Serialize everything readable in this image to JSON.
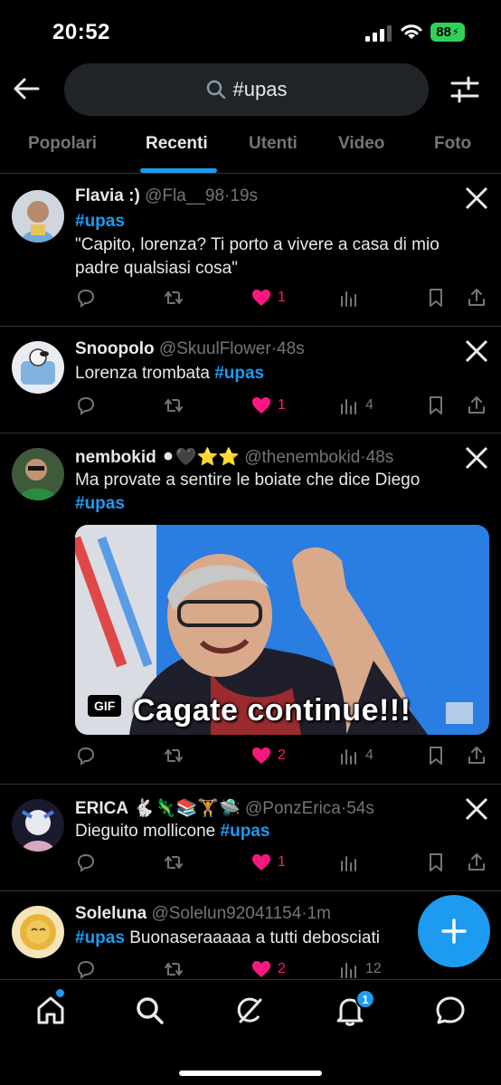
{
  "status_bar": {
    "time": "20:52",
    "battery": "88"
  },
  "search": {
    "query": "#upas"
  },
  "tabs": [
    {
      "label": "Popolari"
    },
    {
      "label": "Recenti"
    },
    {
      "label": "Utenti"
    },
    {
      "label": "Video"
    },
    {
      "label": "Foto"
    }
  ],
  "active_tab": "Recenti",
  "colors": {
    "accent": "#1d9bf0",
    "like": "#f91880",
    "muted": "#71767b",
    "background": "#000000"
  },
  "tweets": [
    {
      "name": "Flavia :)",
      "handle": "@Fla__98",
      "time": "19s",
      "hashtag": "#upas",
      "text": "\"Capito, lorenza? Ti porto a vivere a casa di mio padre qualsiasi cosa\"",
      "likes": "1",
      "views": ""
    },
    {
      "name": "Snoopolo",
      "handle": "@SkuulFlower",
      "time": "48s",
      "text": "Lorenza trombata ",
      "hashtag": "#upas",
      "likes": "1",
      "views": "4"
    },
    {
      "name": "nembokid",
      "name_emoji": "⚫🖤⭐⭐",
      "handle": "@thenembokid",
      "time": "48s",
      "text": "Ma provate a sentire le boiate che dice Diego",
      "hashtag": "#upas",
      "media": {
        "badge": "GIF",
        "caption": "Cagate continue!!!"
      },
      "likes": "2",
      "views": "4"
    },
    {
      "name": "ERICA",
      "name_emoji": "🐇🦎📚🏋🛸",
      "handle": "@PonzErica",
      "time": "54s",
      "text": "Dieguito mollicone ",
      "hashtag": "#upas",
      "likes": "1",
      "views": ""
    },
    {
      "name": "Soleluna",
      "handle": "@Solelun92041154",
      "time": "1m",
      "hashtag": "#upas",
      "text": " Buonaseraaaaa a tutti debosciati",
      "likes": "2",
      "views": "12"
    }
  ],
  "bottom_nav": {
    "notifications_badge": "1"
  },
  "icons": [
    "back-icon",
    "search-icon",
    "filter-icon",
    "x-logo-icon",
    "reply-icon",
    "retweet-icon",
    "heart-icon",
    "views-icon",
    "bookmark-icon",
    "share-icon",
    "plus-icon",
    "home-icon",
    "explore-icon",
    "grok-icon",
    "bell-icon",
    "messages-icon"
  ]
}
